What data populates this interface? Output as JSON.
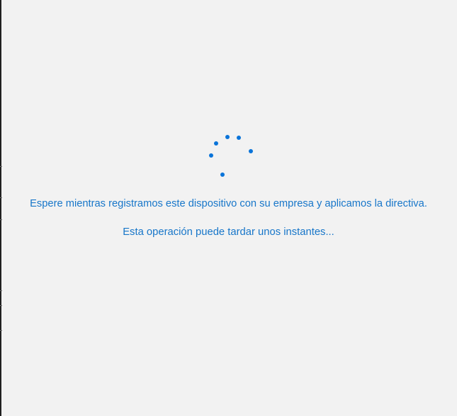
{
  "screen": {
    "status_message": "Espere mientras registramos este dispositivo con su empresa y aplicamos la directiva.",
    "sub_message": "Esta operación puede tardar unos instantes...",
    "accent_color": "#1776c9",
    "spinner_color": "#0a74d9",
    "background_color": "#f2f2f2",
    "spinner_icon": "loading-spinner-icon"
  }
}
